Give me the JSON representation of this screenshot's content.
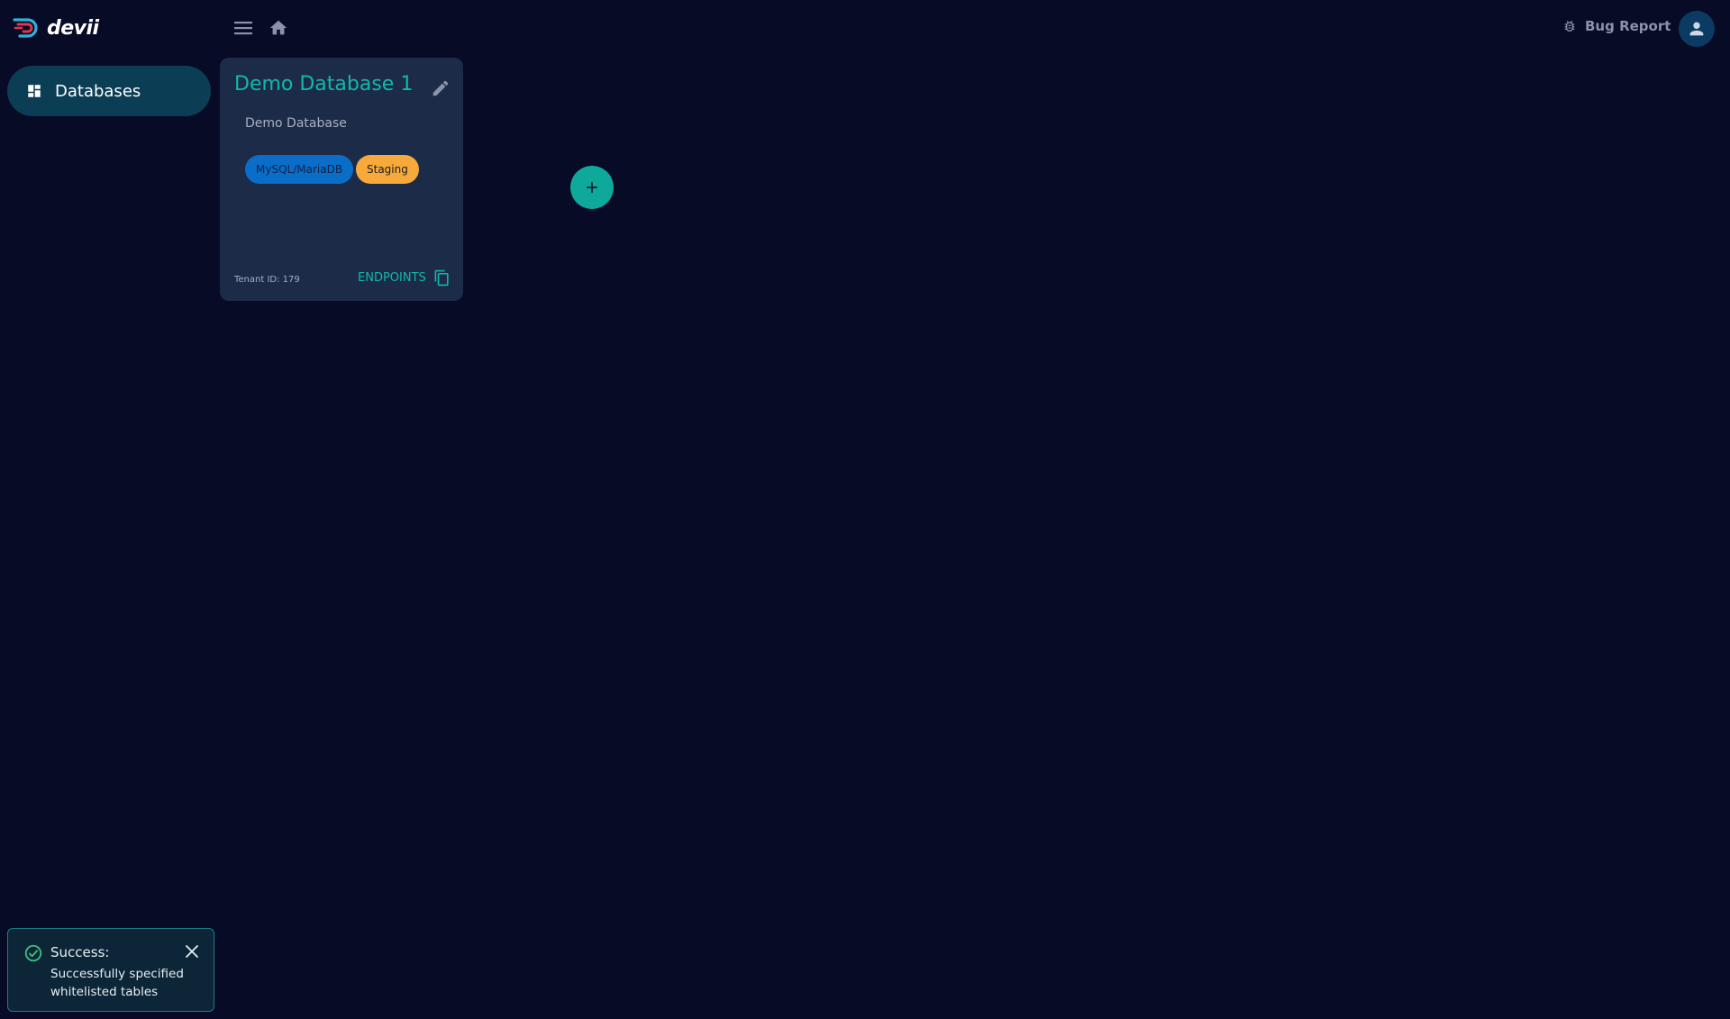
{
  "app": {
    "logo_text": "devii"
  },
  "header": {
    "bug_report_label": "Bug Report"
  },
  "sidebar": {
    "items": [
      {
        "label": "Databases",
        "icon": "dashboard-icon",
        "active": true
      }
    ]
  },
  "databases": [
    {
      "title": "Demo Database 1",
      "description": "Demo Database",
      "type_chip": "MySQL/MariaDB",
      "env_chip": "Staging",
      "tenant_label": "Tenant ID: 179",
      "endpoints_label": "ENDPOINTS"
    }
  ],
  "toast": {
    "title": "Success:",
    "message": "Successfully specified whitelisted tables"
  },
  "colors": {
    "background": "#070b25",
    "accent": "#12b8a8",
    "card": "#1c2b48",
    "chip_type": "#0a6ec9",
    "chip_env": "#f7a93c"
  }
}
